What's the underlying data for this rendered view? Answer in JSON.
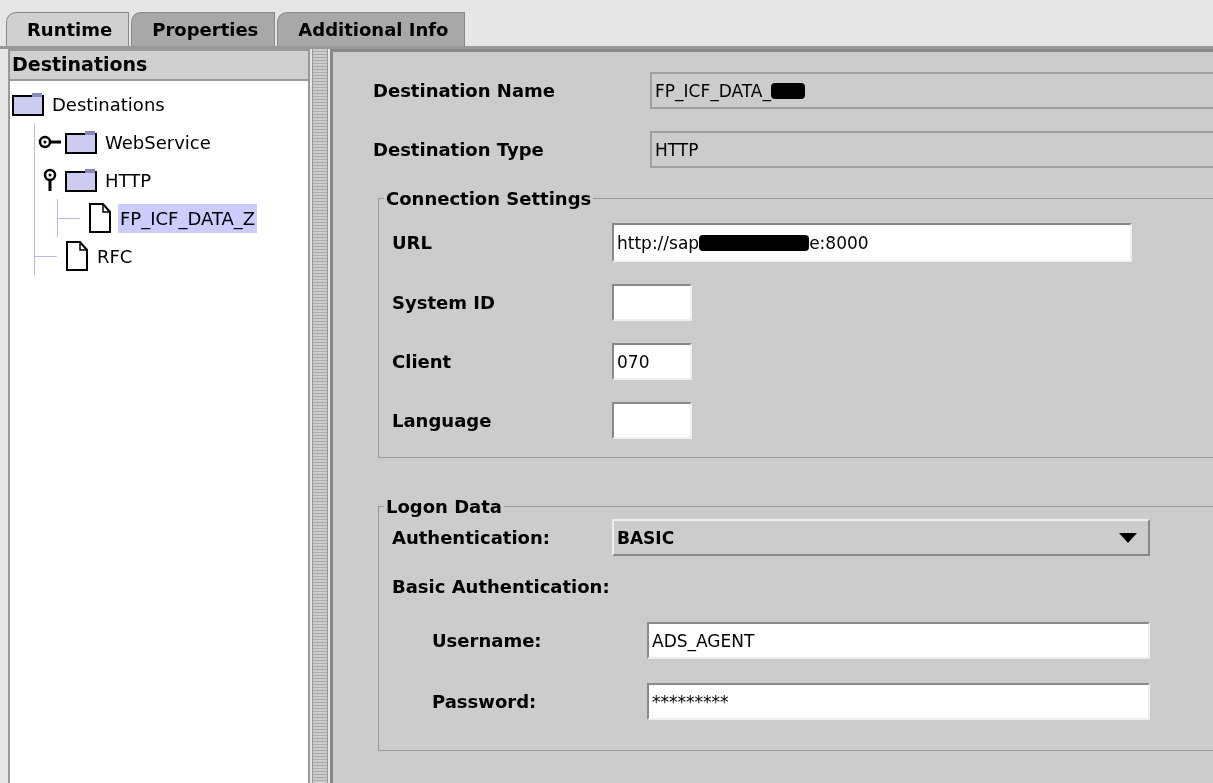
{
  "tabs": [
    {
      "label": "Runtime",
      "selected": true
    },
    {
      "label": "Properties",
      "selected": false
    },
    {
      "label": "Additional Info",
      "selected": false
    }
  ],
  "sidebar": {
    "title": "Destinations",
    "tree": [
      {
        "label": "Destinations",
        "kind": "folder",
        "selected": false,
        "children": [
          {
            "label": "WebService",
            "kind": "folder",
            "expanded": false,
            "selected": false
          },
          {
            "label": "HTTP",
            "kind": "folder",
            "expanded": true,
            "selected": false,
            "children": [
              {
                "label": "FP_ICF_DATA_Z",
                "kind": "document",
                "selected": true
              }
            ]
          },
          {
            "label": "RFC",
            "kind": "document",
            "selected": false
          }
        ]
      }
    ]
  },
  "details": [
    {
      "label": "Destination Name",
      "value": "FP_ICF_DATA_",
      "redacted": true
    },
    {
      "label": "Destination Type",
      "value": "HTTP"
    }
  ],
  "connection_settings": {
    "title": "Connection Settings",
    "fields": [
      {
        "label": "URL",
        "kind": "wide",
        "value": "http://sap",
        "value_after": "e:8000",
        "redacted": true
      },
      {
        "label": "System ID",
        "kind": "short"
      },
      {
        "label": "Client",
        "kind": "short",
        "value": "070"
      },
      {
        "label": "Language",
        "kind": "short"
      }
    ]
  },
  "logon_data": {
    "title": "Logon Data",
    "authentication": {
      "label": "Authentication:",
      "value": "BASIC"
    },
    "subtitle": "Basic Authentication:",
    "fields": [
      {
        "label": "Username:",
        "value": "ADS_AGENT"
      },
      {
        "label": "Password:",
        "value": "*********"
      }
    ]
  }
}
